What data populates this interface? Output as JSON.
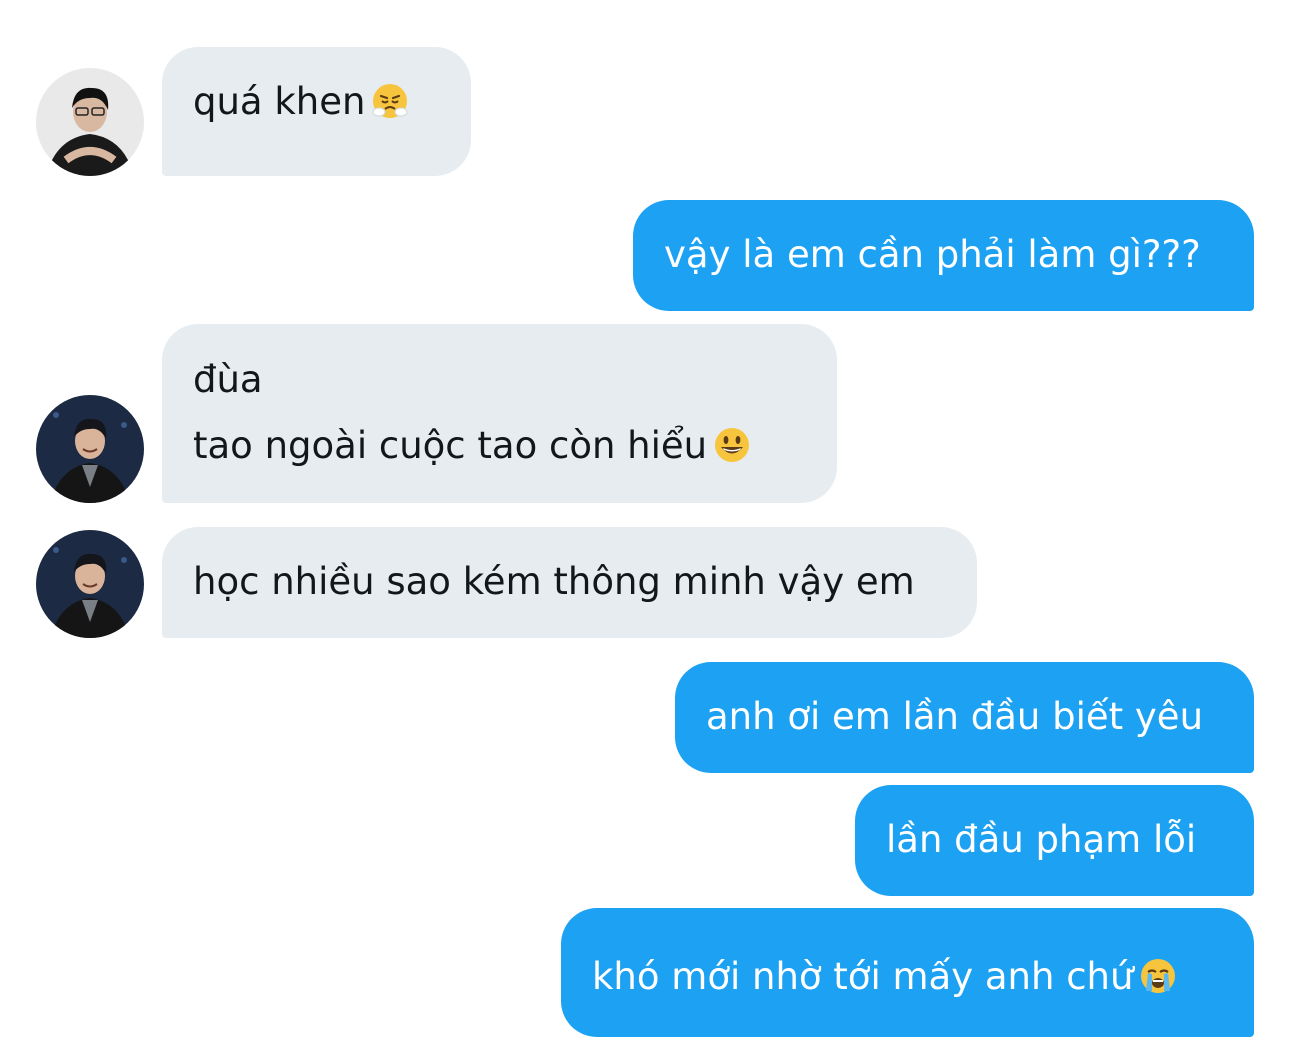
{
  "conversation": {
    "messages": [
      {
        "side": "received",
        "lines": [
          "quá khen"
        ],
        "emoji": "face-with-steam-emoji"
      },
      {
        "side": "sent",
        "lines": [
          "vậy là em cần phải làm gì???"
        ]
      },
      {
        "side": "received",
        "lines": [
          "đùa",
          "tao ngoài cuộc tao còn hiểu"
        ],
        "emoji": "grinning-face-emoji"
      },
      {
        "side": "received",
        "lines": [
          "học nhiều sao kém thông minh vậy em"
        ]
      },
      {
        "side": "sent",
        "lines": [
          "anh ơi em lần đầu biết yêu"
        ]
      },
      {
        "side": "sent",
        "lines": [
          "lần đầu phạm lỗi"
        ]
      },
      {
        "side": "sent",
        "lines": [
          "khó mới nhờ tới mấy anh chứ"
        ],
        "emoji": "loudly-crying-face-emoji"
      }
    ]
  },
  "colors": {
    "received_bubble": "#e6ecf0",
    "received_text": "#14171a",
    "sent_bubble": "#1da1f2",
    "sent_text": "#ffffff"
  },
  "icons": {
    "avatar_1": "avatar-photo-person-dark-shirt",
    "avatar_2": "avatar-photo-person-dark-suit"
  }
}
